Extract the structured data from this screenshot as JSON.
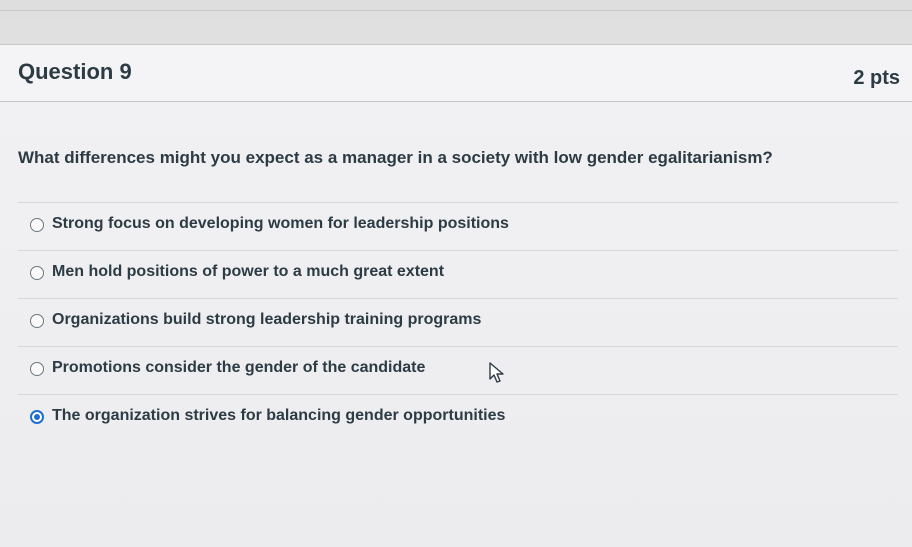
{
  "question": {
    "title": "Question 9",
    "points": "2 pts",
    "prompt": "What differences might you expect as a manager in a society with low gender egalitarianism?"
  },
  "answers": [
    {
      "label": "Strong focus on developing women for leadership positions",
      "selected": false
    },
    {
      "label": "Men hold positions of power to a much great extent",
      "selected": false
    },
    {
      "label": "Organizations build strong leadership training programs",
      "selected": false
    },
    {
      "label": "Promotions consider the gender of the candidate",
      "selected": false
    },
    {
      "label": "The organization strives for balancing gender opportunities",
      "selected": true
    }
  ],
  "colors": {
    "selected_radio": "#1f6fd1",
    "text": "#2d3b45"
  },
  "icons": {
    "cursor": "mouse-pointer-icon"
  }
}
